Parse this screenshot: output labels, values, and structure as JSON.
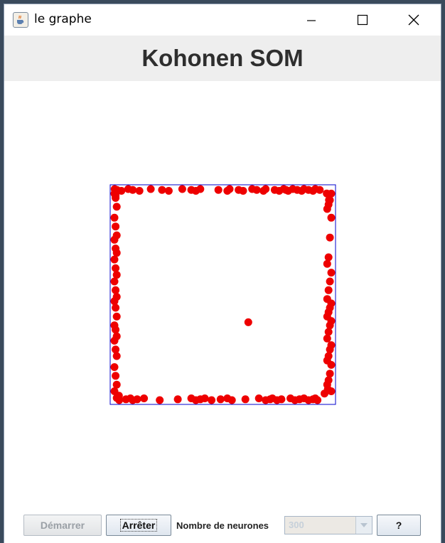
{
  "window": {
    "title": "le graphe"
  },
  "header": {
    "title": "Kohonen SOM"
  },
  "controls": {
    "start_label": "Démarrer",
    "stop_label": "Arrêter",
    "neurons_label": "Nombre de neurones",
    "neurons_value": "300",
    "help_label": "?"
  },
  "colors": {
    "neuron": "#ee0000",
    "frame": "#0000cc",
    "header_bg": "#eeeeee"
  },
  "som": {
    "stray_neurons": [
      [
        0.613,
        0.626
      ]
    ],
    "edge_neurons": {
      "top": [
        0.02,
        0.03,
        0.05,
        0.08,
        0.1,
        0.13,
        0.18,
        0.23,
        0.26,
        0.32,
        0.36,
        0.38,
        0.4,
        0.48,
        0.52,
        0.53,
        0.57,
        0.59,
        0.63,
        0.65,
        0.68,
        0.69,
        0.73,
        0.75,
        0.77,
        0.78,
        0.79,
        0.81,
        0.83,
        0.85,
        0.86,
        0.88,
        0.9,
        0.91,
        0.93
      ],
      "bottom": [
        0.04,
        0.07,
        0.09,
        0.1,
        0.12,
        0.15,
        0.22,
        0.3,
        0.36,
        0.38,
        0.4,
        0.42,
        0.45,
        0.49,
        0.52,
        0.54,
        0.6,
        0.66,
        0.69,
        0.71,
        0.72,
        0.74,
        0.76,
        0.8,
        0.82,
        0.84,
        0.86,
        0.88,
        0.9,
        0.91,
        0.92
      ],
      "left": [
        0.04,
        0.06,
        0.1,
        0.15,
        0.19,
        0.23,
        0.25,
        0.29,
        0.31,
        0.34,
        0.38,
        0.41,
        0.44,
        0.48,
        0.51,
        0.53,
        0.56,
        0.6,
        0.64,
        0.66,
        0.69,
        0.71,
        0.75,
        0.78,
        0.83,
        0.87,
        0.91,
        0.94
      ],
      "right": [
        0.04,
        0.07,
        0.09,
        0.11,
        0.15,
        0.24,
        0.33,
        0.36,
        0.4,
        0.44,
        0.48,
        0.52,
        0.54,
        0.56,
        0.58,
        0.6,
        0.62,
        0.64,
        0.67,
        0.7,
        0.73,
        0.75,
        0.78,
        0.8,
        0.82,
        0.86,
        0.89,
        0.91,
        0.94
      ]
    }
  }
}
